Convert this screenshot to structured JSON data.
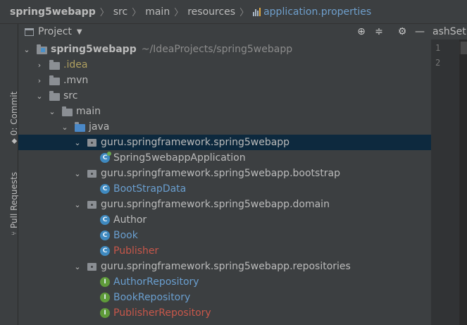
{
  "breadcrumb": {
    "items": [
      "spring5webapp",
      "src",
      "main",
      "resources",
      "application.properties"
    ]
  },
  "tool_strip": {
    "commit_label": "0: Commit",
    "pull_label": "Pull Requests"
  },
  "project_panel": {
    "title": "Project",
    "toolbar_icons": [
      "crosshair-icon",
      "collapse-icon",
      "gear-icon",
      "minimize-icon"
    ]
  },
  "tree": {
    "root_name": "spring5webapp",
    "root_path": "~/IdeaProjects/spring5webapp",
    "idea": ".idea",
    "mvn": ".mvn",
    "src": "src",
    "main": "main",
    "java": "java",
    "pkg_root": "guru.springframework.spring5webapp",
    "app_class": "Spring5webappApplication",
    "pkg_bootstrap": "guru.springframework.spring5webapp.bootstrap",
    "bootstrap_class": "BootStrapData",
    "pkg_domain": "guru.springframework.spring5webapp.domain",
    "author": "Author",
    "book": "Book",
    "publisher": "Publisher",
    "pkg_repositories": "guru.springframework.spring5webapp.repositories",
    "author_repo": "AuthorRepository",
    "book_repo": "BookRepository",
    "publisher_repo": "PublisherRepository"
  },
  "editor": {
    "tab_text": "ashSet.",
    "line_numbers": [
      "1",
      "2"
    ]
  },
  "colors": {
    "selection": "#0d293e",
    "class_blue": "#6a9fd0",
    "error_red": "#c8574a",
    "ignored_yellow": "#b0a060"
  }
}
